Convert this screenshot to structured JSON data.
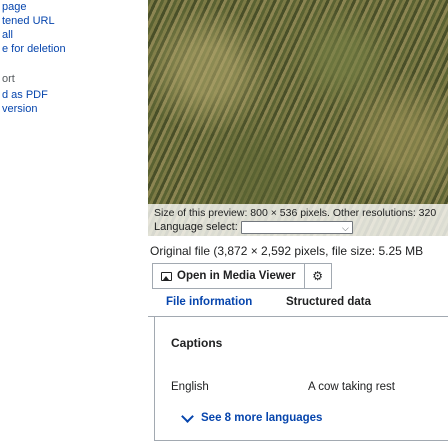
{
  "sidebar": {
    "items": [
      {
        "label": "page",
        "kind": "link"
      },
      {
        "label": "tened URL",
        "kind": "link"
      },
      {
        "label": "all",
        "kind": "link"
      },
      {
        "label": "e for deletion",
        "kind": "link"
      },
      {
        "label": "ort",
        "kind": "heading"
      },
      {
        "label": "d as PDF",
        "kind": "link"
      },
      {
        "label": "version",
        "kind": "link"
      }
    ]
  },
  "preview": {
    "caption": "Size of this preview: 800 × 536 pixels. Other resolutions: 320",
    "language_label": "Language select:",
    "language_value": ""
  },
  "original_file": {
    "text": "Original file (3,872 × 2,592 pixels, file size: 5.25 MB"
  },
  "toolbar": {
    "open_media_viewer": "Open in Media Viewer",
    "settings_icon": "gear-icon",
    "media_icon": "image-icon"
  },
  "tabs": [
    {
      "label": "File information"
    },
    {
      "label": "Structured data"
    }
  ],
  "structured_data": {
    "heading": "Captions",
    "caption_language": "English",
    "caption_text": "A cow taking rest",
    "more_languages": "See 8 more languages"
  },
  "colors": {
    "link": "#0645ad",
    "text": "#202122",
    "border": "#a2a9b1"
  }
}
